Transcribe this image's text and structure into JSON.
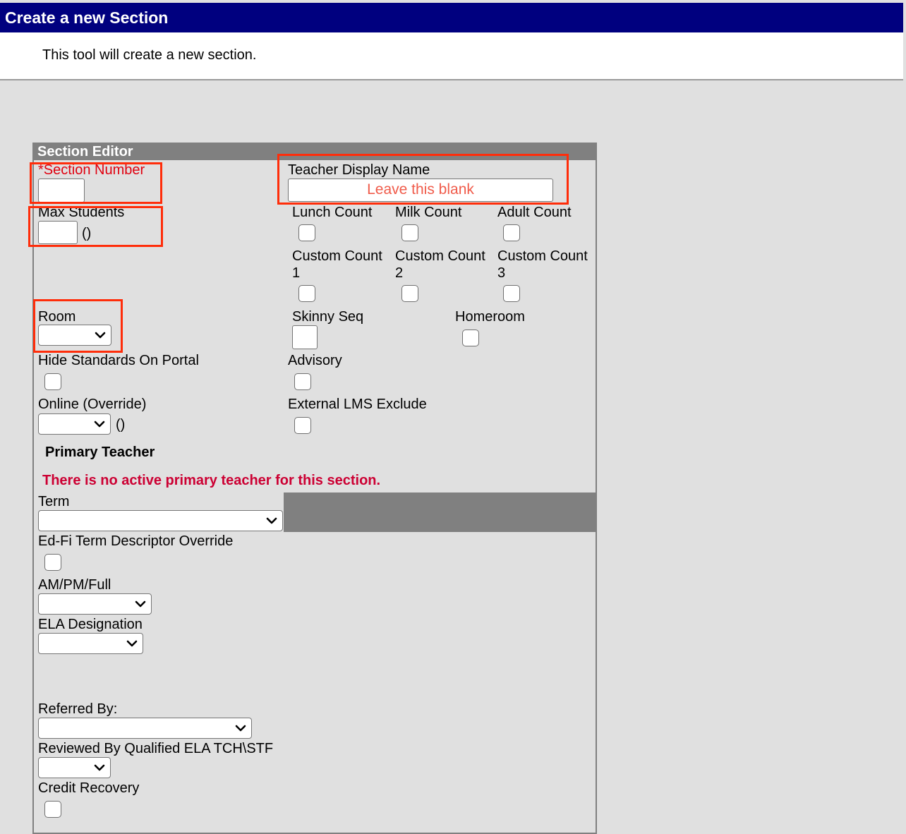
{
  "header": {
    "title": "Create a new Section"
  },
  "intro": {
    "text": "This tool will create a new section."
  },
  "editor": {
    "title": "Section Editor",
    "section_number": {
      "label": "*Section Number",
      "value": ""
    },
    "teacher_display_name": {
      "label": "Teacher Display Name",
      "hint": "Leave this blank"
    },
    "max_students": {
      "label": "Max Students",
      "value": "",
      "suffix": "()"
    },
    "lunch_count": {
      "label": "Lunch Count",
      "checked": false
    },
    "milk_count": {
      "label": "Milk Count",
      "checked": false
    },
    "adult_count": {
      "label": "Adult Count",
      "checked": false
    },
    "custom_count_1": {
      "label_line1": "Custom Count",
      "label_line2": "1",
      "checked": false
    },
    "custom_count_2": {
      "label_line1": "Custom Count",
      "label_line2": "2",
      "checked": false
    },
    "custom_count_3": {
      "label_line1": "Custom Count",
      "label_line2": "3",
      "checked": false
    },
    "room": {
      "label": "Room",
      "value": ""
    },
    "skinny_seq": {
      "label": "Skinny Seq",
      "value": ""
    },
    "homeroom": {
      "label": "Homeroom",
      "checked": false
    },
    "hide_standards": {
      "label": "Hide Standards On Portal",
      "checked": false
    },
    "advisory": {
      "label": "Advisory",
      "checked": false
    },
    "online_override": {
      "label": "Online (Override)",
      "value": "",
      "suffix": "()"
    },
    "external_lms_exclude": {
      "label": "External LMS Exclude",
      "checked": false
    },
    "primary_teacher": {
      "heading": "Primary Teacher",
      "warning": "There is no active primary teacher for this section."
    },
    "term": {
      "label": "Term",
      "value": ""
    },
    "edfi_term": {
      "label": "Ed-Fi Term Descriptor Override",
      "checked": false
    },
    "am_pm_full": {
      "label": "AM/PM/Full",
      "value": ""
    },
    "ela_designation": {
      "label": "ELA Designation",
      "value": ""
    },
    "referred_by": {
      "label": "Referred By:",
      "value": ""
    },
    "reviewed_by": {
      "label": "Reviewed By Qualified ELA TCH\\STF",
      "value": ""
    },
    "credit_recovery": {
      "label": "Credit Recovery",
      "checked": false
    }
  },
  "annotation_color": "#ff2d0a"
}
